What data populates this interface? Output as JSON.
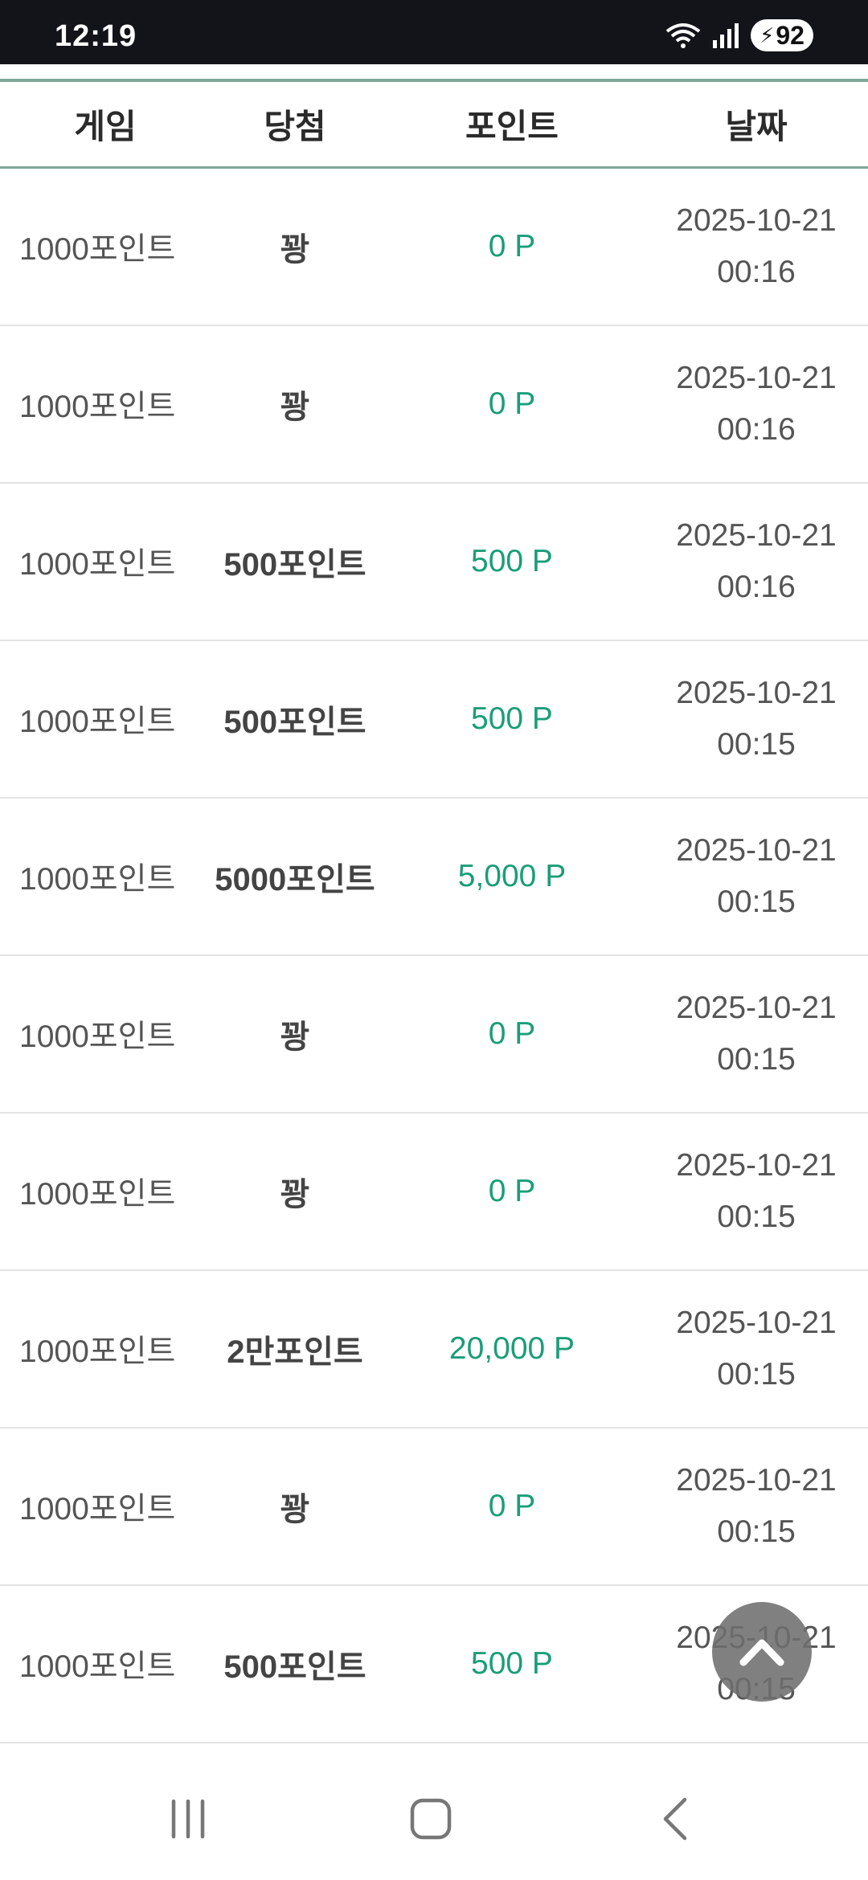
{
  "status_bar": {
    "time": "12:19",
    "battery": "92"
  },
  "table": {
    "headers": {
      "game": "게임",
      "win": "당첨",
      "points": "포인트",
      "date": "날짜"
    },
    "rows": [
      {
        "game": "1000포인트",
        "win": "꽝",
        "points": "0 P",
        "date": "2025-10-21",
        "time": "00:16"
      },
      {
        "game": "1000포인트",
        "win": "꽝",
        "points": "0 P",
        "date": "2025-10-21",
        "time": "00:16"
      },
      {
        "game": "1000포인트",
        "win": "500포인트",
        "points": "500 P",
        "date": "2025-10-21",
        "time": "00:16"
      },
      {
        "game": "1000포인트",
        "win": "500포인트",
        "points": "500 P",
        "date": "2025-10-21",
        "time": "00:15"
      },
      {
        "game": "1000포인트",
        "win": "5000포인트",
        "points": "5,000 P",
        "date": "2025-10-21",
        "time": "00:15"
      },
      {
        "game": "1000포인트",
        "win": "꽝",
        "points": "0 P",
        "date": "2025-10-21",
        "time": "00:15"
      },
      {
        "game": "1000포인트",
        "win": "꽝",
        "points": "0 P",
        "date": "2025-10-21",
        "time": "00:15"
      },
      {
        "game": "1000포인트",
        "win": "2만포인트",
        "points": "20,000 P",
        "date": "2025-10-21",
        "time": "00:15"
      },
      {
        "game": "1000포인트",
        "win": "꽝",
        "points": "0 P",
        "date": "2025-10-21",
        "time": "00:15"
      },
      {
        "game": "1000포인트",
        "win": "500포인트",
        "points": "500 P",
        "date": "2025-10-21",
        "time": "00:15"
      }
    ]
  },
  "colors": {
    "accent_line": "#7fa898",
    "points_green": "#1a9e78",
    "status_bg": "#13141a"
  },
  "icons": {
    "scroll_top": "chevron-up-icon",
    "nav_recent": "recent-apps-icon",
    "nav_home": "home-icon",
    "nav_back": "back-icon"
  }
}
